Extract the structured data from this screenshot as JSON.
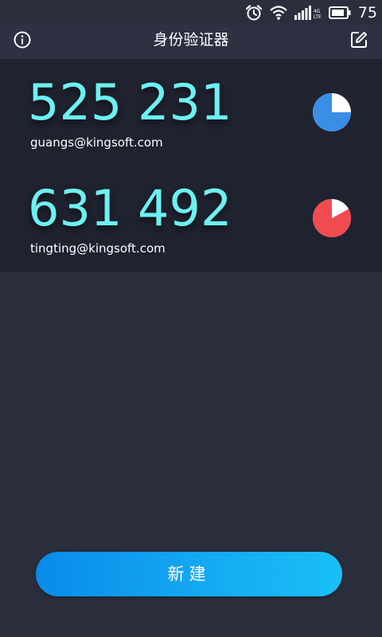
{
  "status_bar": {
    "battery_level": "75",
    "network_label": "4G",
    "network_sub": "LTE"
  },
  "header": {
    "title": "身份验证器"
  },
  "accounts": [
    {
      "code": "525 231",
      "email": "guangs@kingsoft.com",
      "timer_color": "#3a8ee6",
      "timer_remaining_fraction": 0.75
    },
    {
      "code": "631 492",
      "email": "tingting@kingsoft.com",
      "timer_color": "#f14a4f",
      "timer_remaining_fraction": 0.83
    }
  ],
  "actions": {
    "new_label": "新建"
  },
  "colors": {
    "background": "#2a2e3d",
    "card": "#1f222f",
    "code": "#6cf1f2"
  }
}
